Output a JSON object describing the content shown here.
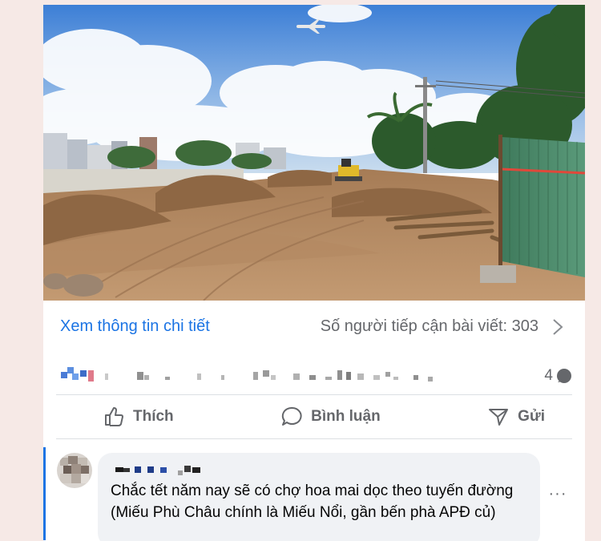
{
  "post": {
    "details_link": "Xem thông tin chi tiết",
    "reach_text": "Số người tiếp cận bài viết: 303",
    "comment_count": "4"
  },
  "actions": {
    "like_label": "Thích",
    "comment_label": "Bình luận",
    "send_label": "Gửi"
  },
  "comment": {
    "text": "Chắc tết năm nay sẽ có chợ hoa mai dọc theo tuyến đường (Miếu Phù Châu chính là Miếu Nổi, gần bến phà APĐ củ)"
  },
  "colors": {
    "accent": "#1b74e4",
    "muted_text": "#65676b",
    "bubble_bg": "#f0f2f5"
  },
  "icons": {
    "chevron": "chevron-right-icon",
    "comment_bubble": "comment-bubble-icon",
    "like": "thumbs-up-icon",
    "comment": "comment-icon",
    "send": "send-icon",
    "more": "more-horizontal-icon"
  }
}
